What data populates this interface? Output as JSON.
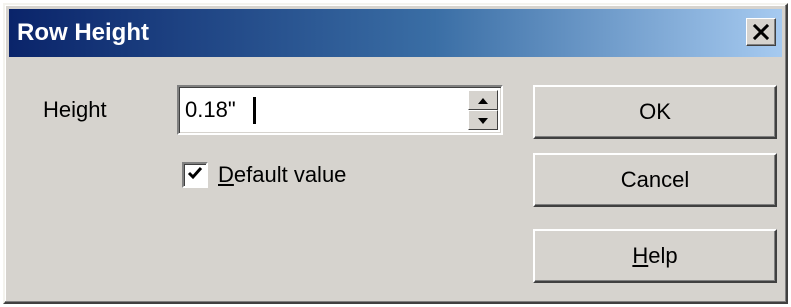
{
  "window": {
    "title": "Row Height",
    "close_icon": "close-icon"
  },
  "form": {
    "height_label": "Height",
    "height_value": "0.18\"",
    "default_checked": true,
    "default_label_mnemonic": "D",
    "default_label_rest": "efault value"
  },
  "buttons": {
    "ok": "OK",
    "cancel": "Cancel",
    "help_mnemonic": "H",
    "help_rest": "elp"
  },
  "icons": {
    "spin_up": "spin-up-icon",
    "spin_down": "spin-down-icon",
    "checkmark": "checkmark-icon"
  },
  "colors": {
    "titlebar_start": "#0a246a",
    "titlebar_end": "#a6caf0",
    "face": "#d6d3ce"
  }
}
